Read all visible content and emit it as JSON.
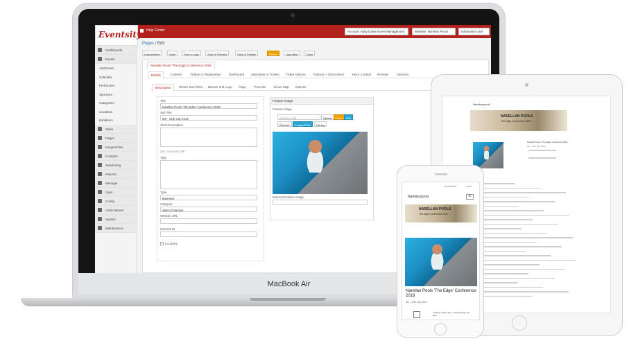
{
  "device_label": "MacBook Air",
  "app": {
    "logo_text": "Eventsity",
    "help_center": "Help Center",
    "account_select": "Account: Abby Dante Event Management",
    "website_select": "Website: Narellan Pools",
    "user_select": "Infomaxim User"
  },
  "sidebar": {
    "items": [
      {
        "label": "Dashboards",
        "sub": false
      },
      {
        "label": "Events",
        "sub": false
      },
      {
        "label": "Add Event",
        "sub": true
      },
      {
        "label": "Calendar",
        "sub": true
      },
      {
        "label": "Performers",
        "sub": true
      },
      {
        "label": "Sponsors",
        "sub": true
      },
      {
        "label": "Categories",
        "sub": true
      },
      {
        "label": "Locations",
        "sub": true
      },
      {
        "label": "Exhibitors",
        "sub": true
      },
      {
        "label": "Sales",
        "sub": false
      },
      {
        "label": "Pages",
        "sub": false
      },
      {
        "label": "Images/Files",
        "sub": false
      },
      {
        "label": "Contacts",
        "sub": false
      },
      {
        "label": "eMarketing",
        "sub": false
      },
      {
        "label": "Reports",
        "sub": false
      },
      {
        "label": "Manager",
        "sub": false
      },
      {
        "label": "Apps",
        "sub": false
      },
      {
        "label": "Config",
        "sub": false
      },
      {
        "label": "Administrator",
        "sub": false
      },
      {
        "label": "System",
        "sub": false
      },
      {
        "label": "Maintenance",
        "sub": false
      }
    ]
  },
  "breadcrumb": {
    "pages": "Pages",
    "edit": "Edit"
  },
  "toolbar": {
    "unpublished": "Unpublished",
    "save": "Save",
    "save_copy": "Save a copy",
    "save_preview": "Save & Preview",
    "save_publish": "Save & Publish",
    "delete": "Delete",
    "unpublish": "Unpublish",
    "close": "Close"
  },
  "page_tab_title": "Narellan Pools 'The Edge' Conference 2019",
  "tabs": [
    "Details",
    "Content",
    "Tickets or Registration",
    "Dashboard",
    "Attendees or Tickets",
    "Ticket Options",
    "Patrons + Subscribers",
    "More Content",
    "Preview",
    "Versions"
  ],
  "subtabs": [
    "Description",
    "Where and When",
    "Banner and Logo",
    "Page",
    "Promote",
    "Venue Map",
    "Options"
  ],
  "form": {
    "title_label": "Title",
    "title_value": "Narellan Pools 'The Edge' Conference 2019",
    "subtitle_label": "Sub Title",
    "subtitle_value": "9th - 13th July 2019",
    "short_desc_label": "Short Description",
    "chars_left": "250 characters left",
    "tags_label": "Tags",
    "type_label": "Type",
    "type_value": "Business",
    "category_label": "Category",
    "category_value": "Select Category",
    "website_url_label": "Website URL",
    "external_id_label": "External ID",
    "in_library_label": "In Library"
  },
  "feature": {
    "panel_title": "Feature Image",
    "label": "Feature Image",
    "file_placeholder": "choose a file",
    "upload": "Upload",
    "clear": "Clear",
    "edit": "Edit",
    "choose": "Choose:",
    "images_files": "Images/Files",
    "library": "Library",
    "external_label": "External Feature Image"
  },
  "mobile": {
    "brand": "Narellanpools",
    "nav_profile": "MY PROFILE",
    "nav_cart": "CART",
    "banner_title": "NARELLAN POOLS",
    "banner_sub": "The Edge Conference 2019",
    "event_title": "Narellan Pools 'The Edge' Conference 2019",
    "event_dates": "9th - 13th July 2019",
    "date_detail": "Tuesday July 9, 4pm - Saturday July 13, 9pm"
  },
  "tablet": {
    "brand": "Narellanpools",
    "banner_title": "NARELLAN POOLS",
    "banner_sub": "The Edge Conference 2019",
    "event_title": "Narellan Pools 'The Edge' Conference 2019",
    "event_dates": "9th - 13th July 2019"
  },
  "colors": {
    "brand_red": "#b3211d",
    "link_blue": "#2a6ebb",
    "delete_orange": "#f0a000"
  }
}
